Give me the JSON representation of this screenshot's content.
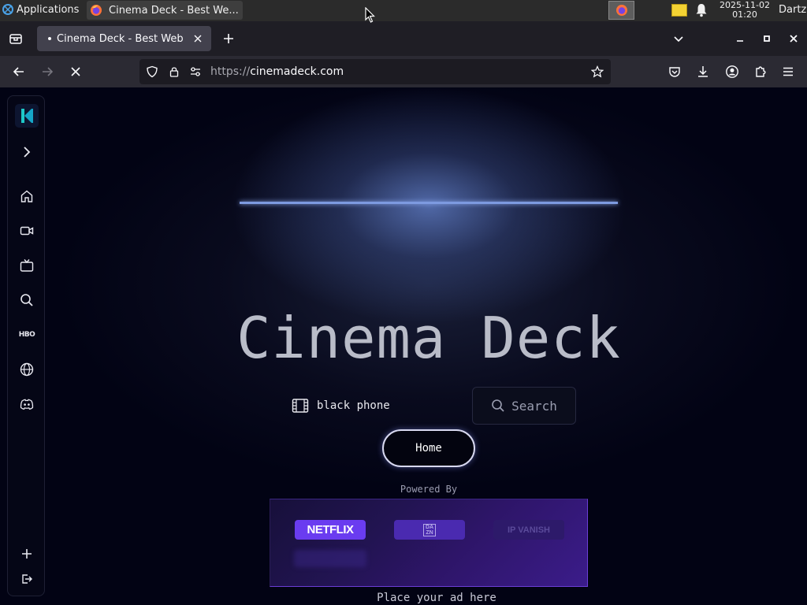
{
  "os": {
    "applications_label": "Applications",
    "task_title": "Cinema Deck - Best We...",
    "clock_date": "2025-11-02",
    "clock_time": "01:20",
    "user": "Dartz"
  },
  "browser": {
    "tab_title": "Cinema Deck - Best Web",
    "url_scheme": "https://",
    "url_host": "cinemadeck.com"
  },
  "page": {
    "hero_title": "Cinema Deck",
    "search": {
      "value": "black phone",
      "button_label": "Search"
    },
    "home_button": "Home",
    "powered_by": "Powered By",
    "sponsors": [
      {
        "label": "NETFLIX"
      },
      {
        "label": "DA ZN"
      },
      {
        "label": "IP VANISH"
      }
    ],
    "ad_text": "Place your ad here"
  },
  "sidebar": {
    "items": [
      "logo",
      "expand",
      "home",
      "movies",
      "tv",
      "search",
      "hbo",
      "globe",
      "discord",
      "add",
      "logout"
    ],
    "hbo_label": "HBO"
  },
  "colors": {
    "page_bg": "#020314",
    "accent_purple": "#6a3cf0",
    "logo_teal": "#1ec8c8"
  }
}
